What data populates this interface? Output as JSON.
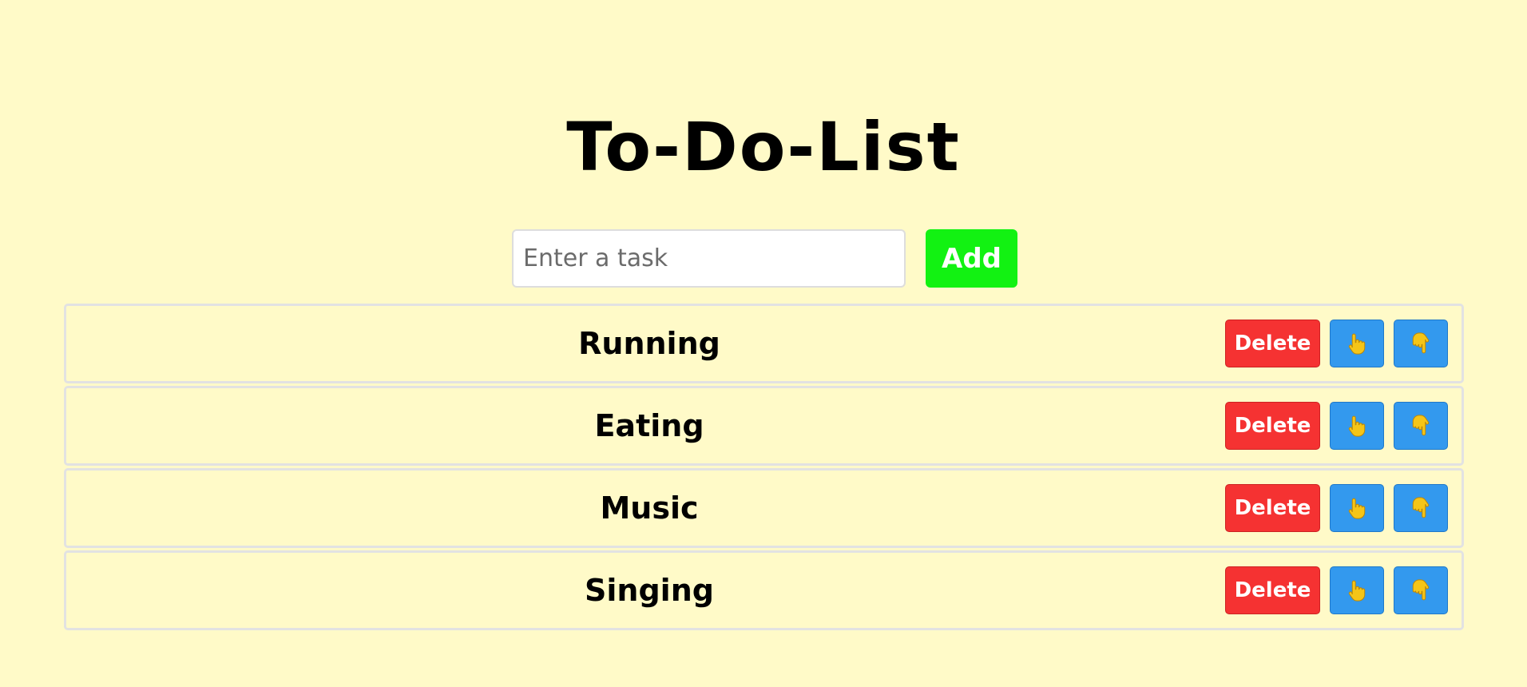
{
  "app": {
    "title": "To-Do-List"
  },
  "input": {
    "placeholder": "Enter a task",
    "value": ""
  },
  "add_button": {
    "label": "Add"
  },
  "tasks": [
    {
      "text": "Running",
      "delete_label": "Delete",
      "up_icon": "hand-pointing-up-icon",
      "down_icon": "hand-pointing-down-icon"
    },
    {
      "text": "Eating",
      "delete_label": "Delete",
      "up_icon": "hand-pointing-up-icon",
      "down_icon": "hand-pointing-down-icon"
    },
    {
      "text": "Music",
      "delete_label": "Delete",
      "up_icon": "hand-pointing-up-icon",
      "down_icon": "hand-pointing-down-icon"
    },
    {
      "text": "Singing",
      "delete_label": "Delete",
      "up_icon": "hand-pointing-up-icon",
      "down_icon": "hand-pointing-down-icon"
    }
  ],
  "colors": {
    "background": "#fffac8",
    "add_button": "#12f212",
    "delete_button": "#f53232",
    "move_button": "#3399ee",
    "hand_icon": "#f5c518",
    "item_border": "#e2e2e2"
  }
}
